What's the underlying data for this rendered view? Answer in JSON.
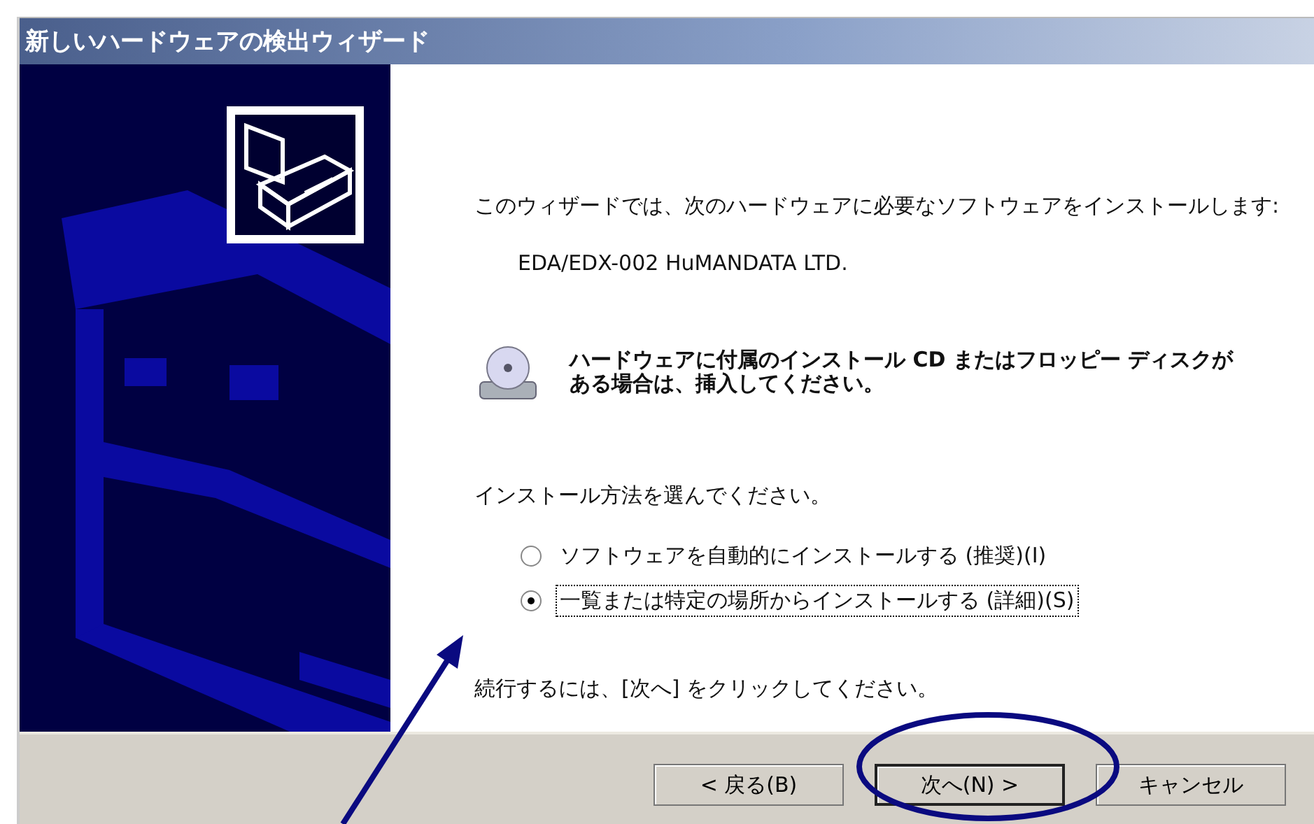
{
  "window": {
    "title": "新しいハードウェアの検出ウィザード"
  },
  "content": {
    "intro": "このウィザードでは、次のハードウェアに必要なソフトウェアをインストールします:",
    "device": "EDA/EDX-002 HuMANDATA LTD.",
    "cd_prompt": "ハードウェアに付属のインストール CD またはフロッピー ディスクがある場合は、挿入してください。",
    "method_prompt": "インストール方法を選んでください。",
    "options": [
      {
        "label": "ソフトウェアを自動的にインストールする (推奨)(I)",
        "selected": false,
        "focused": false
      },
      {
        "label": "一覧または特定の場所からインストールする (詳細)(S)",
        "selected": true,
        "focused": true
      }
    ],
    "continue_hint": "続行するには、[次へ] をクリックしてください。"
  },
  "buttons": [
    {
      "label": "< 戻る(B)",
      "default": false
    },
    {
      "label": "次へ(N) >",
      "default": true
    },
    {
      "label": "キャンセル",
      "default": false
    }
  ]
}
